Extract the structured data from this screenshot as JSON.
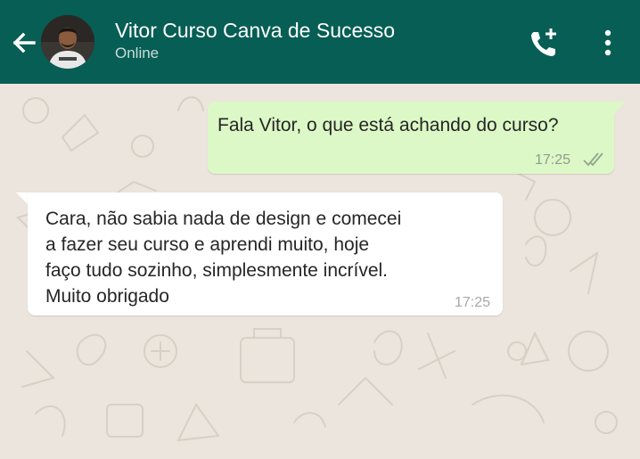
{
  "header": {
    "contact_name": "Vitor Curso Canva de Sucesso",
    "status": "Online",
    "back_icon": "arrow-left-icon",
    "call_icon": "add-call-icon",
    "menu_icon": "more-vertical-icon",
    "background_color": "#075e54"
  },
  "chat": {
    "background_color": "#ece5dd",
    "messages": [
      {
        "direction": "outgoing",
        "text": "Fala Vitor, o que está  achando do curso?",
        "time": "17:25",
        "status_icon": "double-check-icon",
        "bubble_color": "#dcf8c6"
      },
      {
        "direction": "incoming",
        "text": "Cara, não sabia nada de design e comecei\na fazer seu curso e aprendi muito, hoje\nfaço tudo sozinho, simplesmente incrível.\nMuito obrigado",
        "time": "17:25",
        "bubble_color": "#ffffff"
      }
    ]
  }
}
